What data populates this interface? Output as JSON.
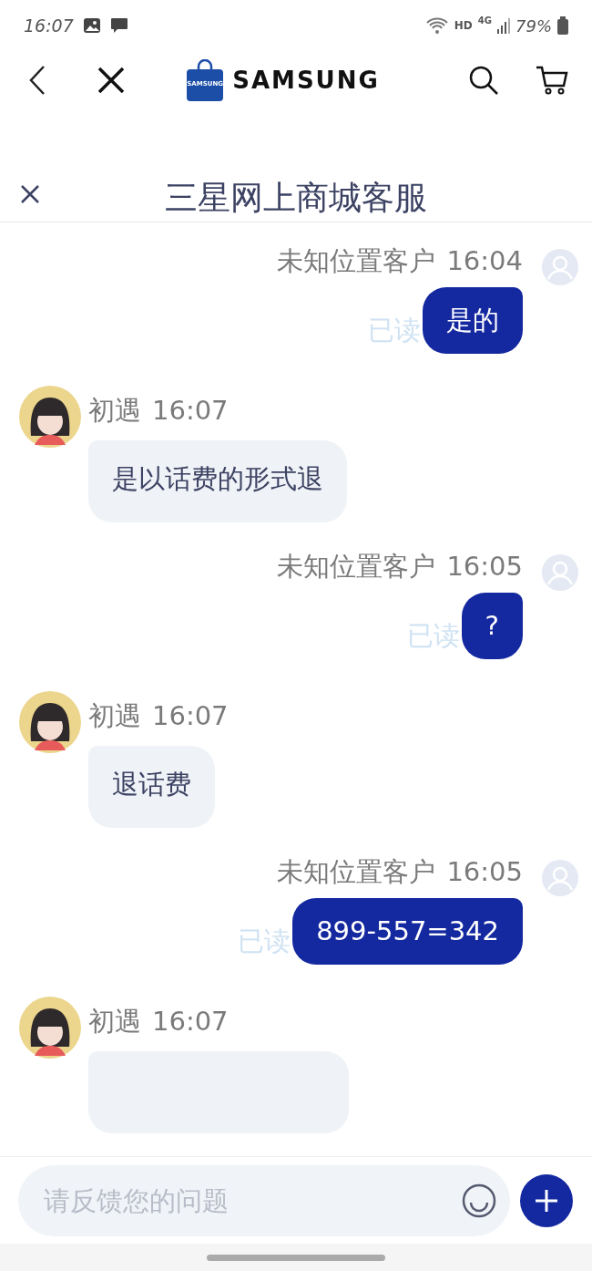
{
  "status_bar": {
    "time": "16:07",
    "hd": "HD",
    "network": "4G",
    "battery": "79%"
  },
  "app_bar": {
    "logo_text": "SAMSUNG",
    "bag_text": "SAMSUNG"
  },
  "chat": {
    "title": "三星网上商城客服"
  },
  "messages": [
    {
      "kind": "sent",
      "sender": "未知位置客户",
      "time": "16:04",
      "text": "是的",
      "status": "已读"
    },
    {
      "kind": "received",
      "sender": "初遇",
      "time": "16:07",
      "text": "是以话费的形式退"
    },
    {
      "kind": "sent",
      "sender": "未知位置客户",
      "time": "16:05",
      "text": "?",
      "status": "已读"
    },
    {
      "kind": "received",
      "sender": "初遇",
      "time": "16:07",
      "text": "退话费"
    },
    {
      "kind": "sent",
      "sender": "未知位置客户",
      "time": "16:05",
      "text": "899-557=342",
      "status": "已读"
    },
    {
      "kind": "received",
      "sender": "初遇",
      "time": "16:07"
    }
  ],
  "input": {
    "placeholder": "请反馈您的问题"
  }
}
